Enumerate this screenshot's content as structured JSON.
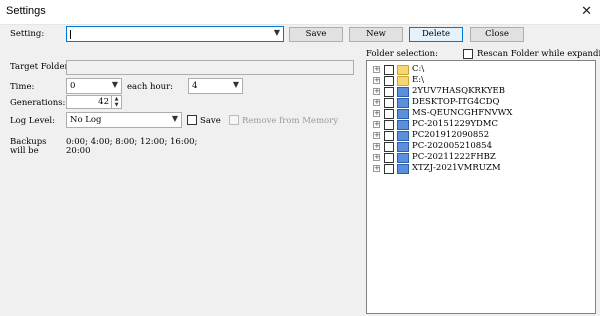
{
  "window": {
    "title": "Settings",
    "close_glyph": "✕"
  },
  "setting": {
    "label": "Setting:",
    "value": ""
  },
  "buttons": {
    "save": "Save",
    "new": "New",
    "delete": "Delete",
    "close": "Close"
  },
  "folder_selection": {
    "label": "Folder selection:",
    "rescan_label": "Rescan Folder while expanding",
    "rescan_checked": false
  },
  "target_folder": {
    "label": "Target Folder",
    "value": ""
  },
  "time": {
    "label": "Time:",
    "value": "0",
    "each_hour_label": "each hour:",
    "each_hour_value": "4"
  },
  "generations": {
    "label": "Generations:",
    "value": "42"
  },
  "log_level": {
    "label": "Log Level:",
    "value": "No Log",
    "save_label": "Save",
    "save_checked": false,
    "remove_label": "Remove from Memory",
    "remove_enabled": false
  },
  "backups": {
    "label_line1": "Backups",
    "label_line2": "will be",
    "value_line1": "0:00; 4:00; 8:00; 12:00; 16:00;",
    "value_line2": "20:00"
  },
  "tree": {
    "drives": [
      "C:\\",
      "E:\\"
    ],
    "computers": [
      "2YUV7HASQKRKYEB",
      "DESKTOP-ITG4CDQ",
      "MS-QEUNCGHFNVWX",
      "PC-20151229YDMC",
      "PC201912090852",
      "PC-202005210854",
      "PC-20211222FHBZ",
      "XTZJ-2021VMRUZM"
    ]
  },
  "icons": {
    "expand": "plus-box-icon",
    "drive_folder": "folder-icon",
    "computer": "computer-icon",
    "dropdown": "chevron-down-icon"
  }
}
